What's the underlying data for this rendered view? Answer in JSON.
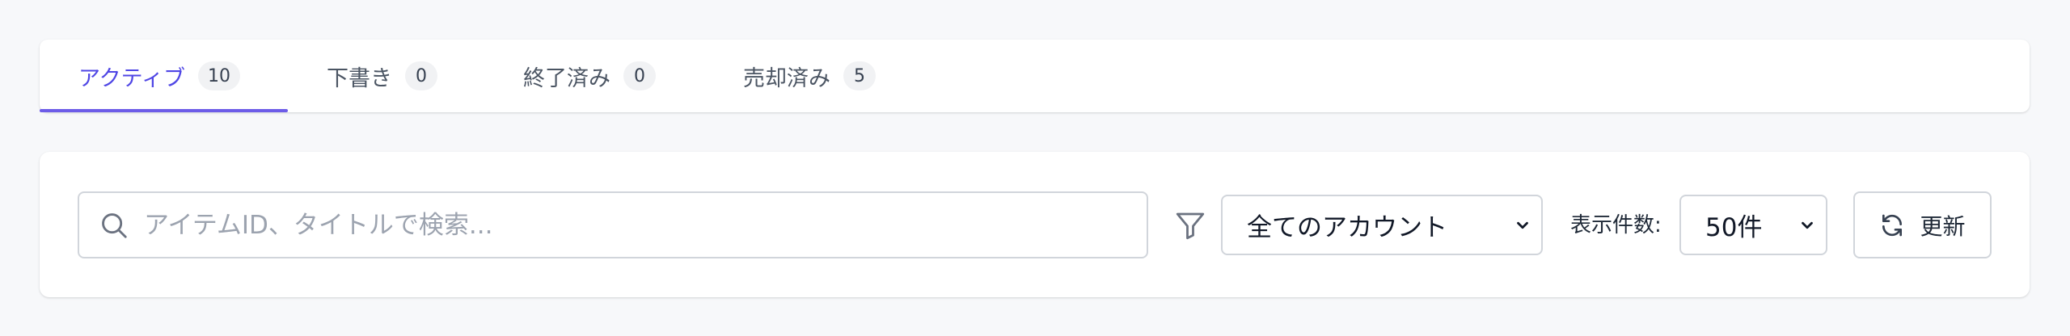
{
  "tabs": [
    {
      "label": "アクティブ",
      "count": "10",
      "active": true
    },
    {
      "label": "下書き",
      "count": "0",
      "active": false
    },
    {
      "label": "終了済み",
      "count": "0",
      "active": false
    },
    {
      "label": "売却済み",
      "count": "5",
      "active": false
    }
  ],
  "filters": {
    "search_placeholder": "アイテムID、タイトルで検索...",
    "search_value": "",
    "account_select_value": "全てのアカウント",
    "per_page_label": "表示件数:",
    "per_page_value": "50件",
    "refresh_label": "更新"
  },
  "icons": {
    "search": "search-icon",
    "filter": "filter-icon",
    "refresh": "refresh-icon",
    "chevron": "chevron-down-icon"
  },
  "colors": {
    "accent": "#4f46e5",
    "tab_indicator": "#6d5ce8"
  }
}
